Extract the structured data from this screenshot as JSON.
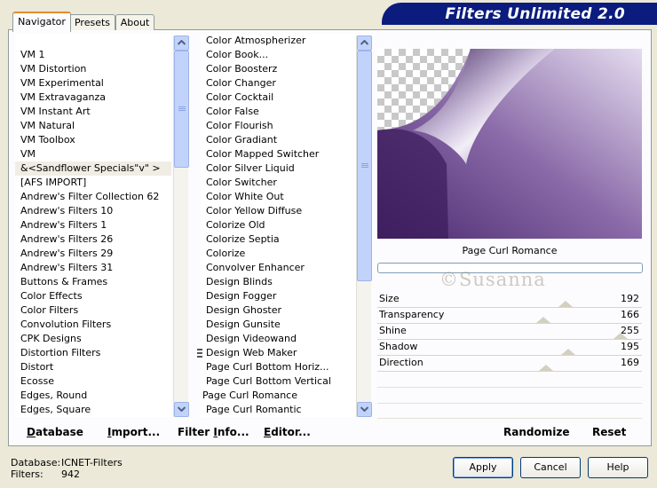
{
  "tabs": [
    "Navigator",
    "Presets",
    "About"
  ],
  "title": "Filters Unlimited 2.0",
  "categories": [
    "VM 1",
    "VM Distortion",
    "VM Experimental",
    "VM Extravaganza",
    "VM Instant Art",
    "VM Natural",
    "VM Toolbox",
    "VM",
    "&<Sandflower Specials\"v\" >",
    "[AFS IMPORT]",
    "Andrew's Filter Collection 62",
    "Andrew's Filters 10",
    "Andrew's Filters 1",
    "Andrew's Filters 26",
    "Andrew's Filters 29",
    "Andrew's Filters 31",
    "Buttons & Frames",
    "Color Effects",
    "Color Filters",
    "Convolution Filters",
    "CPK Designs",
    "Distortion Filters",
    "Distort",
    "Ecosse",
    "Edges, Round",
    "Edges, Square"
  ],
  "selected_category_index": 8,
  "filters": [
    "Color Atmospherizer",
    "Color Book...",
    "Color Boosterz",
    "Color Changer",
    "Color Cocktail",
    "Color False",
    "Color Flourish",
    "Color Gradiant",
    "Color Mapped Switcher",
    "Color Silver Liquid",
    "Color Switcher",
    "Color White Out",
    "Color Yellow Diffuse",
    "Colorize Old",
    "Colorize Septia",
    "Colorize",
    "Convolver Enhancer",
    "Design Blinds",
    "Design Fogger",
    "Design Ghoster",
    "Design Gunsite",
    "Design Videowand",
    "Design Web Maker",
    "Page Curl Bottom Horiz...",
    "Page Curl Bottom Vertical",
    "Page Curl Romance",
    "Page Curl Romantic"
  ],
  "selected_filter_index": 25,
  "preview_filter_name": "Page Curl Romance",
  "watermark": "©Susanna",
  "params": [
    {
      "label": "Size",
      "value": "192",
      "fraction": 0.753
    },
    {
      "label": "Transparency",
      "value": "166",
      "fraction": 0.651
    },
    {
      "label": "Shine",
      "value": "255",
      "fraction": 1.0
    },
    {
      "label": "Shadow",
      "value": "195",
      "fraction": 0.765
    },
    {
      "label": "Direction",
      "value": "169",
      "fraction": 0.663
    }
  ],
  "bottom_buttons": {
    "database": {
      "u": "D",
      "rest": "atabase"
    },
    "import": {
      "u": "I",
      "rest": "mport..."
    },
    "filter_info": {
      "pre": "Filter ",
      "u": "I",
      "rest": "nfo..."
    },
    "editor": {
      "u": "E",
      "rest": "ditor..."
    },
    "randomize": "Randomize",
    "reset": "Reset"
  },
  "status": {
    "database_label": "Database:",
    "database_value": "ICNET-Filters",
    "filters_label": "Filters:",
    "filters_value": "942"
  },
  "dialog_buttons": {
    "apply": "Apply",
    "cancel": "Cancel",
    "help": "Help"
  },
  "colors": {
    "selection": "#316ac5",
    "title_bar": "#0b1c7e",
    "accent_tab": "#e68b2c"
  }
}
